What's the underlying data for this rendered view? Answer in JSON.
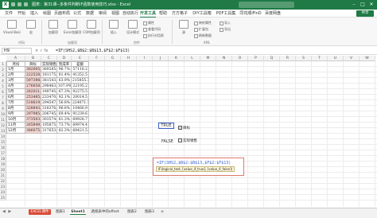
{
  "titlebar": {
    "title": "图表：第31课--多条件判断IF函数使用技巧.xlsx - Excel",
    "min": "–",
    "max": "□",
    "close": "✕"
  },
  "tabs": [
    "文件",
    "开始",
    "插入",
    "绘图",
    "页面布局",
    "公式",
    "数据",
    "审阅",
    "视图",
    "自动执行",
    "开发工具",
    "帮助",
    "方方格子",
    "DIY工具箱",
    "PDF工具集",
    "同花顺iFinD",
    "百度网盘"
  ],
  "share_label": "共享",
  "ribbon": {
    "groups": [
      {
        "name": "代码",
        "buttons": [
          "Visual Basic",
          "宏"
        ]
      },
      {
        "name": "加载项",
        "buttons": [
          "加载项",
          "Excel加载项",
          "COM加载项"
        ]
      },
      {
        "name": "控件",
        "buttons": [
          "插入",
          "设计模式"
        ]
      },
      {
        "name": "XML",
        "buttons": [
          "源"
        ]
      }
    ],
    "small": [
      "属性",
      "查看代码",
      "执行对话框",
      "映射属性",
      "导入",
      "扩展包",
      "导出",
      "刷新数据"
    ]
  },
  "formula_bar": {
    "name_box": "H9",
    "fx": "× ✓ fx",
    "formula": "=IF(SHS2,$B$2:$B$13,$F$2:$F$13)"
  },
  "columns": [
    "A",
    "B",
    "C",
    "D",
    "E",
    "F",
    "G",
    "H",
    "I",
    "J",
    "K",
    "L",
    "M",
    "N",
    "O",
    "P",
    "Q",
    "R",
    "S",
    "T",
    "U",
    "V",
    "W"
  ],
  "rows": [
    "1",
    "2",
    "3",
    "4",
    "5",
    "6",
    "7",
    "8",
    "9",
    "10",
    "11",
    "12",
    "13",
    "14",
    "15",
    "16",
    "17",
    "18",
    "19",
    "20",
    "21",
    "22",
    "23",
    "24",
    "25"
  ],
  "table": {
    "headers": [
      "月份",
      "目标",
      "实际销售",
      "完成率",
      "差额"
    ],
    "rows": [
      [
        "1月",
        "382005.9",
        "369285.6",
        "96.7%",
        "57118.2"
      ],
      [
        "2月",
        "222528.2",
        "181175.7",
        "81.4%",
        "41352.5"
      ],
      [
        "3月",
        "597398.7",
        "381543.4",
        "63.9%",
        "215855.3"
      ],
      [
        "4月",
        "276658.4",
        "298463.6",
        "107.9%",
        "22195.2"
      ],
      [
        "5月",
        "282021.2",
        "189745.7",
        "67.3%",
        "92275.5"
      ],
      [
        "6月",
        "253485.1",
        "233470.6",
        "92.1%",
        "20014.5"
      ],
      [
        "7月",
        "518619.0",
        "294547.9",
        "56.8%",
        "224071.1"
      ],
      [
        "8月",
        "328843.1",
        "318376.2",
        "96.8%",
        "10466.9"
      ],
      [
        "9月",
        "297985.0",
        "206745.4",
        "69.4%",
        "91239.6"
      ],
      [
        "10月",
        "373503.2",
        "303574.5",
        "81.3%",
        "69928.7"
      ],
      [
        "11月",
        "265849.6",
        "195875.2",
        "73.7%",
        "69974.4"
      ],
      [
        "12月",
        "386075.3",
        "317653.8",
        "82.3%",
        "68421.5"
      ]
    ]
  },
  "controls": {
    "true_label": "TRUE",
    "false_label": "FALSE",
    "check1": "目标",
    "check2": "实际销售"
  },
  "formula_box": {
    "formula": "=IF(SHS2,$B$2:$B$13,$F$2:$F$13)",
    "tip": "IF(logical_test, [value_if_true], [value_if_false])"
  },
  "sheets": {
    "nav": "◀ ▶",
    "tabs": [
      "EXCEL课件",
      "图表1",
      "Sheet1",
      "透视表中的offset",
      "图表2",
      "图表3"
    ],
    "add": "+"
  },
  "colors": {
    "brand": "#1f7a45",
    "pink": "#f8d7d3",
    "sheet_excel": "#d94a36"
  }
}
